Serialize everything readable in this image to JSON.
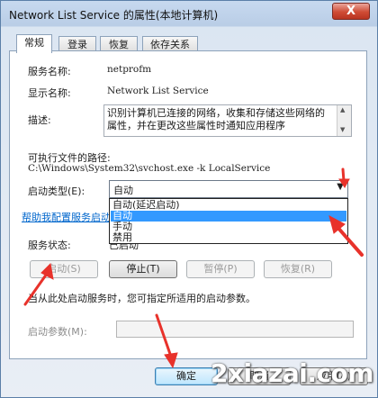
{
  "window": {
    "title": "Network List Service 的属性(本地计算机)",
    "close_glyph": "X"
  },
  "tabs": [
    {
      "label": "常规",
      "active": true
    },
    {
      "label": "登录",
      "active": false
    },
    {
      "label": "恢复",
      "active": false
    },
    {
      "label": "依存关系",
      "active": false
    }
  ],
  "general": {
    "service_name_label": "服务名称:",
    "service_name": "netprofm",
    "display_name_label": "显示名称:",
    "display_name": "Network List Service",
    "description_label": "描述:",
    "description": "识别计算机已连接的网络，收集和存储这些网络的属性，并在更改这些属性时通知应用程序",
    "path_label": "可执行文件的路径:",
    "path": "C:\\Windows\\System32\\svchost.exe -k LocalService",
    "startup_type_label": "启动类型(E):",
    "startup_type_value": "自动",
    "startup_options": [
      "自动(延迟启动)",
      "自动",
      "手动",
      "禁用"
    ],
    "startup_selected_index": 1,
    "help_link": "帮助我配置服务启动",
    "status_label": "服务状态:",
    "status_value": "已启动",
    "buttons": {
      "start": "启动(S)",
      "stop": "停止(T)",
      "pause": "暂停(P)",
      "resume": "恢复(R)"
    },
    "hint": "当从此处启动服务时，您可指定所适用的启动参数。",
    "params_label": "启动参数(M):",
    "params_value": ""
  },
  "footer": {
    "ok": "确定",
    "cancel": "取消",
    "apply": "应用(A)"
  },
  "watermark": "2xiazai.com",
  "colors": {
    "accent": "#3399ff",
    "link": "#0066cc",
    "annotation_arrow": "#e8322b"
  }
}
